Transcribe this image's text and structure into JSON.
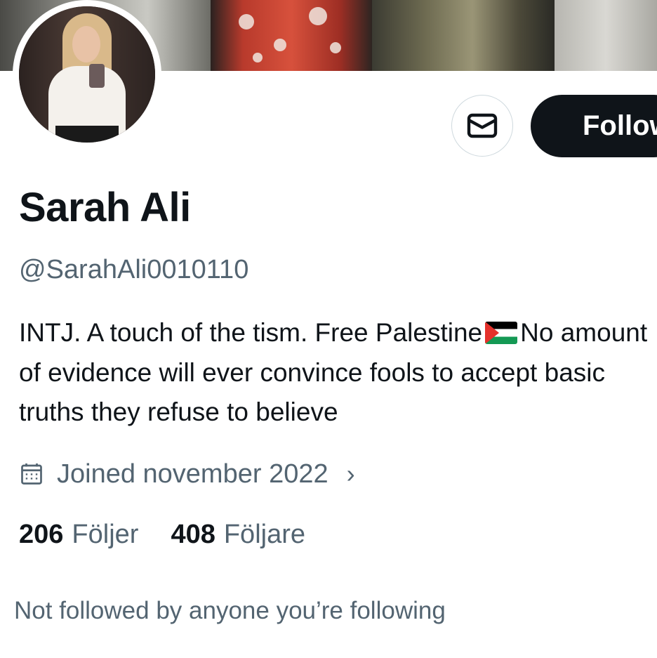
{
  "profile": {
    "name": "Sarah Ali",
    "handle": "@SarahAli0010110",
    "bio_part1": "INTJ. A touch of the tism. Free Palestine",
    "bio_flag": "palestine-flag-emoji",
    "bio_part2": "No amount of evidence will ever convince  fools to accept basic truths they refuse to believe",
    "joined": "Joined november 2022",
    "following_count": "206",
    "following_label": "Följer",
    "followers_count": "408",
    "followers_label": "Följare",
    "mutuals_note": "Not followed by anyone you’re following"
  },
  "actions": {
    "message_icon": "envelope-icon",
    "follow_label": "Follow"
  },
  "colors": {
    "text_primary": "#0f1419",
    "text_secondary": "#536471",
    "button_dark": "#0f1419",
    "border": "#cfd9de"
  }
}
